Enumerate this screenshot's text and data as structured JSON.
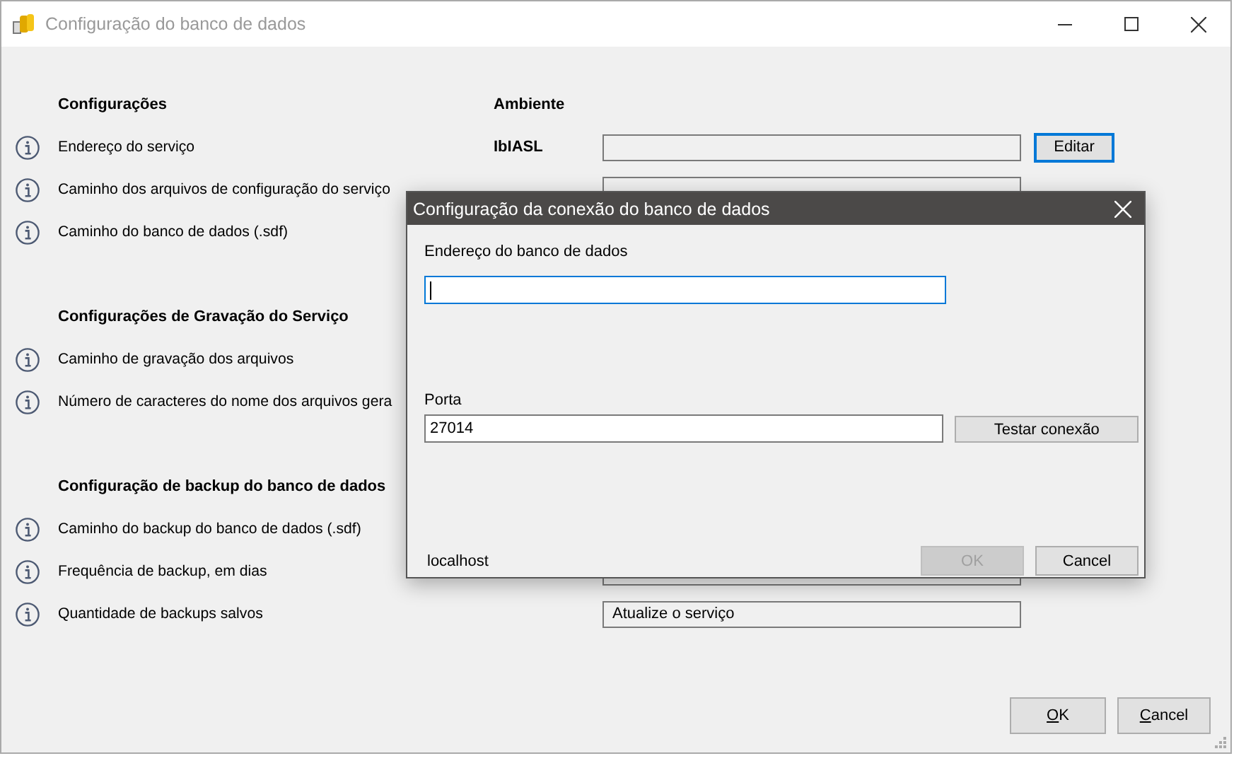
{
  "window": {
    "title": "Configuração do banco de dados"
  },
  "sections": [
    {
      "heading": "Configurações",
      "column_heading": "Ambiente",
      "rows": [
        {
          "label": "Endereço do serviço",
          "environment": "IbIASL",
          "field": {},
          "button": {
            "label": "Editar",
            "focused": true
          }
        },
        {
          "label": "Caminho dos arquivos de configuração do serviço",
          "field": {}
        },
        {
          "label": "Caminho do banco de dados (.sdf)"
        }
      ]
    },
    {
      "heading": "Configurações de Gravação do Serviço",
      "rows": [
        {
          "label": "Caminho de gravação dos arquivos"
        },
        {
          "label": "Número de caracteres do nome dos arquivos gera"
        }
      ]
    },
    {
      "heading": "Configuração de backup do banco de dados",
      "rows": [
        {
          "label": "Caminho do backup do banco de dados (.sdf)"
        },
        {
          "label": "Frequência de backup, em dias",
          "field": {}
        },
        {
          "label": "Quantidade de backups salvos",
          "field": {
            "value": "Atualize o serviço"
          }
        }
      ]
    }
  ],
  "buttons": [
    {
      "label": "OK",
      "mnemonic": true
    },
    {
      "label": "Cancel",
      "mnemonic": true
    }
  ],
  "dialog": {
    "title": "Configuração da conexão do banco de dados",
    "address_label": "Endereço do banco de dados",
    "address_focused": true,
    "port_label": "Porta",
    "port_value": "27014",
    "test_button": "Testar conexão",
    "status": "localhost",
    "buttons": [
      {
        "label": "OK",
        "disabled": true
      },
      {
        "label": "Cancel",
        "disabled": false
      }
    ]
  }
}
